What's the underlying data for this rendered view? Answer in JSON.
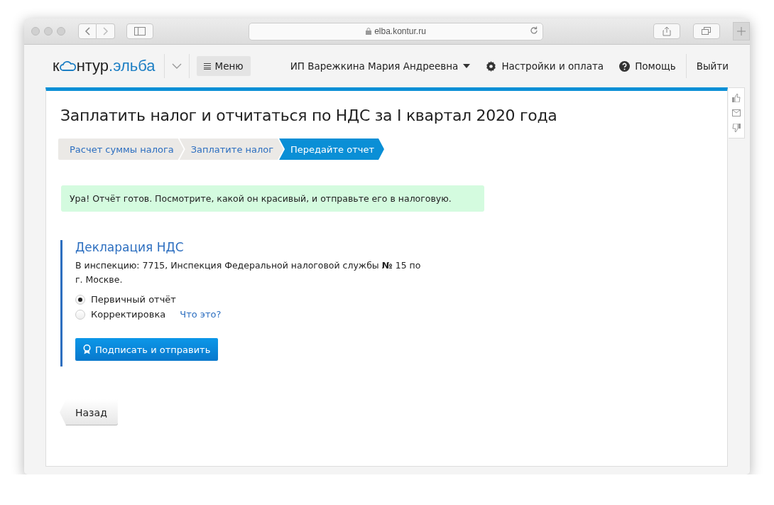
{
  "browser": {
    "address": "elba.kontur.ru"
  },
  "header": {
    "logo": {
      "start": "к",
      "end": "нтур",
      "brand": ".эльба"
    },
    "menu": "Меню",
    "user": "ИП Варежкина Мария Андреевна",
    "settings": "Настройки и оплата",
    "help": "Помощь",
    "logout": "Выйти"
  },
  "page": {
    "title": "Заплатить налог и отчитаться по НДС за I квартал 2020 года",
    "steps": [
      {
        "label": "Расчет суммы налога",
        "selected": false
      },
      {
        "label": "Заплатите налог",
        "selected": false
      },
      {
        "label": "Передайте отчет",
        "selected": true
      }
    ],
    "notice": "Ура! Отчёт готов. Посмотрите, какой он красивый, и отправьте его в налоговую.",
    "declaration": {
      "title": "Декларация НДС",
      "inspection": "В инспекцию: 7715, Инспекция Федеральной налоговой службы **№** 15 по г. Москве.",
      "options": [
        {
          "label": "Первичный отчёт",
          "selected": true
        },
        {
          "label": "Корректировка",
          "selected": false,
          "help": "Что это?"
        }
      ],
      "submit": "Подписать и отправить"
    },
    "back": "Назад"
  }
}
